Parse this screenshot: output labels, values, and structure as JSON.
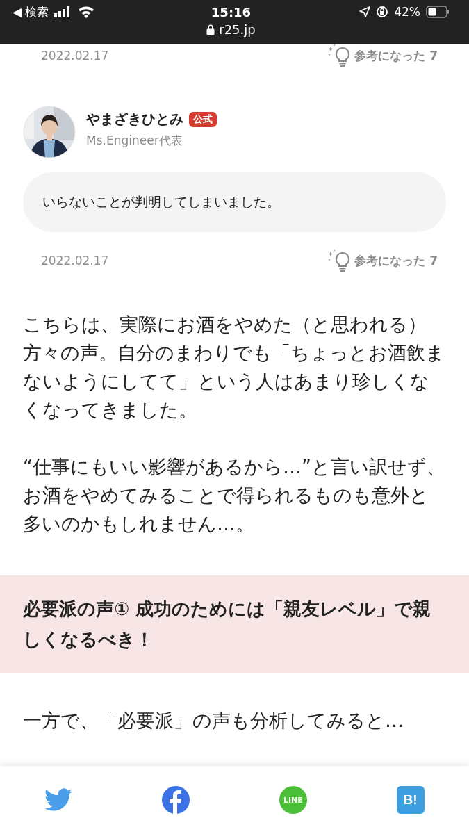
{
  "status_bar": {
    "back": "◀ 検索",
    "time": "15:16",
    "url": "r25.jp",
    "battery": "42%"
  },
  "comments": [
    {
      "date": "2022.02.17",
      "helpful": "参考になった 7"
    },
    {
      "name": "やまざきひとみ",
      "badge": "公式",
      "role": "Ms.Engineer代表",
      "text": "いらないことが判明してしまいました。",
      "date": "2022.02.17",
      "helpful": "参考になった 7"
    }
  ],
  "paragraphs": [
    "こちらは、実際にお酒をやめた（と思われる）方々の声。自分のまわりでも「ちょっとお酒飲まないようにしてて」という人はあまり珍しくなくなってきました。",
    "“仕事にもいい影響があるから…”と言い訳せず、お酒をやめてみることで得られるものも意外と多いのかもしれません…。"
  ],
  "heading": "必要派の声① 成功のためには「親友レベル」で親しくなるべき！",
  "lead": "一方で、「必要派」の声も分析してみると…",
  "share": [
    {
      "kind": "twitter"
    },
    {
      "kind": "facebook"
    },
    {
      "kind": "line",
      "label": "LINE"
    },
    {
      "kind": "hatena",
      "label": "B!"
    }
  ]
}
